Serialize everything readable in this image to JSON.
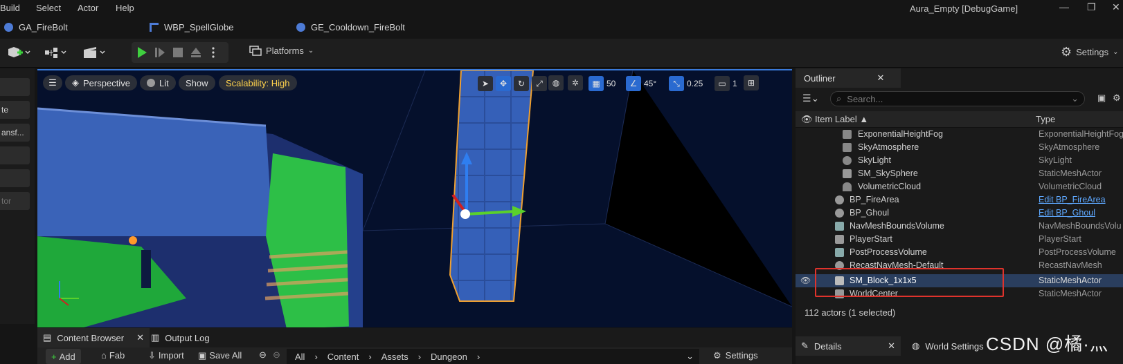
{
  "menu": {
    "items": [
      "Build",
      "Select",
      "Actor",
      "Help"
    ],
    "window_title": "Aura_Empty [DebugGame]"
  },
  "asset_tabs": [
    {
      "label": "GA_FireBolt",
      "icon": "gameplay-ability-icon"
    },
    {
      "label": "WBP_SpellGlobe",
      "icon": "widget-blueprint-icon"
    },
    {
      "label": "GE_Cooldown_FireBolt",
      "icon": "gameplay-effect-icon"
    }
  ],
  "toolbar": {
    "platforms_label": "Platforms",
    "settings_label": "Settings"
  },
  "left_panel": {
    "items": [
      "",
      "te",
      "ansf...",
      "",
      "",
      "tor"
    ]
  },
  "viewport": {
    "perspective_label": "Perspective",
    "lit_label": "Lit",
    "show_label": "Show",
    "scalability_label": "Scalability: High",
    "grid_snap_value": "50",
    "rotation_snap_value": "45°",
    "scale_snap_value": "0.25",
    "camera_speed_value": "1"
  },
  "outliner": {
    "tab_label": "Outliner",
    "search_placeholder": "Search...",
    "col_label": "Item Label ▲",
    "col_type": "Type",
    "rows": [
      {
        "label": "ExponentialHeightFog",
        "type": "ExponentialHeightFog"
      },
      {
        "label": "SkyAtmosphere",
        "type": "SkyAtmosphere"
      },
      {
        "label": "SkyLight",
        "type": "SkyLight"
      },
      {
        "label": "SM_SkySphere",
        "type": "StaticMeshActor"
      },
      {
        "label": "VolumetricCloud",
        "type": "VolumetricCloud"
      },
      {
        "label": "BP_FireArea",
        "type": "Edit BP_FireArea"
      },
      {
        "label": "BP_Ghoul",
        "type": "Edit BP_Ghoul"
      },
      {
        "label": "NavMeshBoundsVolume",
        "type": "NavMeshBoundsVolu"
      },
      {
        "label": "PlayerStart",
        "type": "PlayerStart"
      },
      {
        "label": "PostProcessVolume",
        "type": "PostProcessVolume"
      },
      {
        "label": "RecastNavMesh-Default",
        "type": "RecastNavMesh"
      },
      {
        "label": "SM_Block_1x1x5",
        "type": "StaticMeshActor"
      },
      {
        "label": "WorldCenter",
        "type": "StaticMeshActor"
      }
    ],
    "actor_count": "112 actors (1 selected)"
  },
  "bottom": {
    "content_browser_tab": "Content Browser",
    "output_log_tab": "Output Log",
    "add_label": "Add",
    "fab_label": "Fab",
    "import_label": "Import",
    "save_all_label": "Save All",
    "breadcrumb": [
      "All",
      "Content",
      "Assets",
      "Dungeon"
    ],
    "settings_label": "Settings"
  },
  "details": {
    "details_tab": "Details",
    "world_settings_tab": "World Settings"
  },
  "watermark": "CSDN @橘·灬",
  "colors": {
    "accent": "#2a6ad0",
    "selection": "#2a3e5e",
    "highlight_box": "#e0332c",
    "scalability": "#ffd24d",
    "link": "#5ea8ff"
  }
}
